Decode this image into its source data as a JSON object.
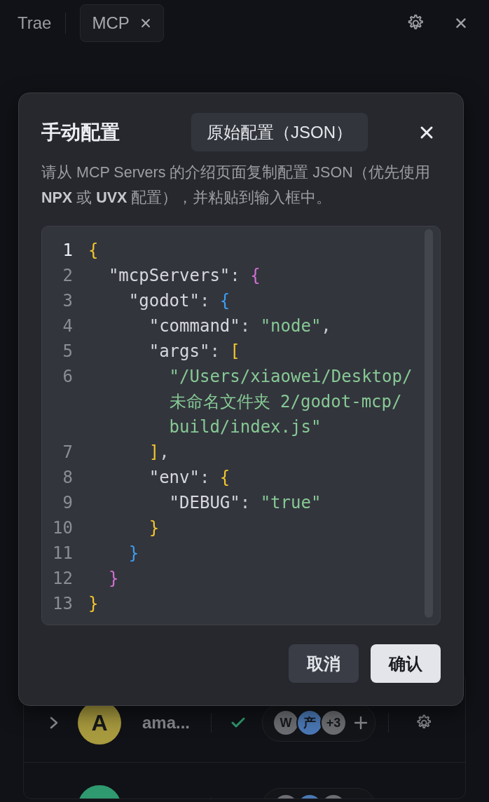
{
  "top_bar": {
    "app_name": "Trae",
    "tabs": [
      {
        "label": "MCP",
        "selected": true
      }
    ]
  },
  "servers": [
    {
      "avatar": "A",
      "color": "#a89a3e",
      "name": "ama...",
      "expanded": false,
      "connected": true,
      "tools": [
        {
          "label": "W",
          "color": "#6b6d72"
        },
        {
          "label": "产",
          "color": "#4a78b5"
        },
        {
          "label": "+3",
          "color": "#6b6d72"
        }
      ]
    },
    {
      "color": "#2f9a6f",
      "tools": [
        {
          "color": "#6b6d72"
        },
        {
          "color": "#4a78b5"
        },
        {
          "color": "#6b6d72"
        }
      ]
    }
  ],
  "dialog": {
    "title": "手动配置",
    "mode_button": "原始配置（JSON）",
    "description": "请从 MCP Servers 的介绍页面复制配置 JSON（优先使用 **NPX** 或 **UVX** 配置），并粘贴到输入框中。",
    "code_lines": [
      {
        "number": "1",
        "active": true,
        "tokens": [
          {
            "kind": "bracket",
            "text": "{",
            "color": "#f2c52e"
          }
        ]
      },
      {
        "number": "2",
        "active": false,
        "tokens": [
          {
            "kind": "key",
            "text": "  \"mcpServers\""
          },
          {
            "kind": "punct",
            "text": ": "
          },
          {
            "kind": "bracket",
            "text": "{",
            "color": "#d070d0"
          }
        ]
      },
      {
        "number": "3",
        "active": false,
        "tokens": [
          {
            "kind": "key",
            "text": "    \"godot\""
          },
          {
            "kind": "punct",
            "text": ": "
          },
          {
            "kind": "bracket",
            "text": "{",
            "color": "#3d9ef0"
          }
        ]
      },
      {
        "number": "4",
        "active": false,
        "tokens": [
          {
            "kind": "key",
            "text": "      \"command\""
          },
          {
            "kind": "punct",
            "text": ": "
          },
          {
            "kind": "string",
            "text": "\"node\""
          },
          {
            "kind": "punct",
            "text": ","
          }
        ]
      },
      {
        "number": "5",
        "active": false,
        "tokens": [
          {
            "kind": "key",
            "text": "      \"args\""
          },
          {
            "kind": "punct",
            "text": ": "
          },
          {
            "kind": "bracket",
            "text": "[",
            "color": "#f2c52e"
          }
        ]
      },
      {
        "number": "6",
        "active": false,
        "tokens": [
          {
            "kind": "string",
            "text": "        \"/Users/xiaowei/Desktop/未命名文件夹 2/godot-mcp/build/index.js\""
          }
        ]
      },
      {
        "number": "7",
        "active": false,
        "tokens": [
          {
            "kind": "bracket",
            "text": "      ]",
            "color": "#f2c52e"
          },
          {
            "kind": "punct",
            "text": ","
          }
        ]
      },
      {
        "number": "8",
        "active": false,
        "tokens": [
          {
            "kind": "key",
            "text": "      \"env\""
          },
          {
            "kind": "punct",
            "text": ": "
          },
          {
            "kind": "bracket",
            "text": "{",
            "color": "#f2c52e"
          }
        ]
      },
      {
        "number": "9",
        "active": false,
        "tokens": [
          {
            "kind": "key",
            "text": "        \"DEBUG\""
          },
          {
            "kind": "punct",
            "text": ": "
          },
          {
            "kind": "string",
            "text": "\"true\""
          }
        ]
      },
      {
        "number": "10",
        "active": false,
        "tokens": [
          {
            "kind": "bracket",
            "text": "      }",
            "color": "#f2c52e"
          }
        ]
      },
      {
        "number": "11",
        "active": false,
        "tokens": [
          {
            "kind": "bracket",
            "text": "    }",
            "color": "#3d9ef0"
          }
        ]
      },
      {
        "number": "12",
        "active": false,
        "tokens": [
          {
            "kind": "bracket",
            "text": "  }",
            "color": "#d070d0"
          }
        ]
      },
      {
        "number": "13",
        "active": false,
        "tokens": [
          {
            "kind": "bracket",
            "text": "}",
            "color": "#f2c52e"
          }
        ]
      }
    ],
    "buttons": [
      {
        "label": "取消",
        "kind": "secondary"
      },
      {
        "label": "确认",
        "kind": "primary"
      }
    ]
  }
}
